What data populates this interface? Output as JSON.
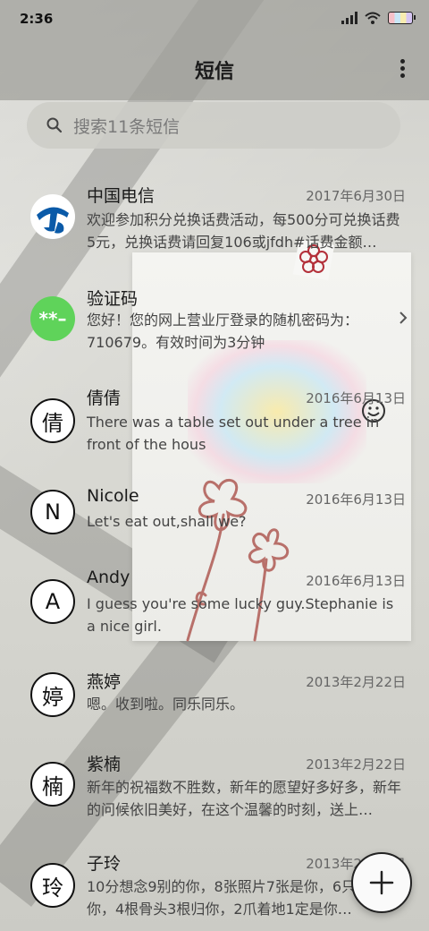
{
  "status": {
    "time": "2:36"
  },
  "header": {
    "title": "短信"
  },
  "search": {
    "placeholder": "搜索11条短信"
  },
  "messages": [
    {
      "name": "中国电信",
      "date": "2017年6月30日",
      "preview": "欢迎参加积分兑换话费活动，每500分可兑换话费5元，兑换话费请回复106或jfdh#话费金额…",
      "avatar_icon": "china-telecom-logo-icon"
    },
    {
      "name": "验证码",
      "date": "",
      "preview": "您好！您的网上营业厅登录的随机密码为：710679。有效时间为3分钟",
      "avatar_text": "**–"
    },
    {
      "name": "倩倩",
      "date": "2016年6月13日",
      "preview": "There was a table set out under a tree in front of the hous",
      "avatar_text": "倩"
    },
    {
      "name": "Nicole",
      "date": "2016年6月13日",
      "preview": "Let's eat out,shall we?",
      "avatar_text": "N"
    },
    {
      "name": "Andy",
      "date": "2016年6月13日",
      "preview": "I guess you're some lucky guy.Stephanie is a nice girl.",
      "avatar_text": "A"
    },
    {
      "name": "燕婷",
      "date": "2013年2月22日",
      "preview": "嗯。收到啦。同乐同乐。",
      "avatar_text": "婷"
    },
    {
      "name": "紫楠",
      "date": "2013年2月22日",
      "preview": "新年的祝福数不胜数，新年的愿望好多好多，新年的问候依旧美好，在这个温馨的时刻，送上…",
      "avatar_text": "楠"
    },
    {
      "name": "子玲",
      "date": "2013年2月22日",
      "preview": "10分想念9别的你，8张照片7张是你，6只…只像你，4根骨头3根归你，2爪着地1定是你…",
      "avatar_text": "玲"
    }
  ],
  "colors": {
    "verify_avatar": "#5fd35a",
    "telecom_blue": "#0a5aa8"
  }
}
